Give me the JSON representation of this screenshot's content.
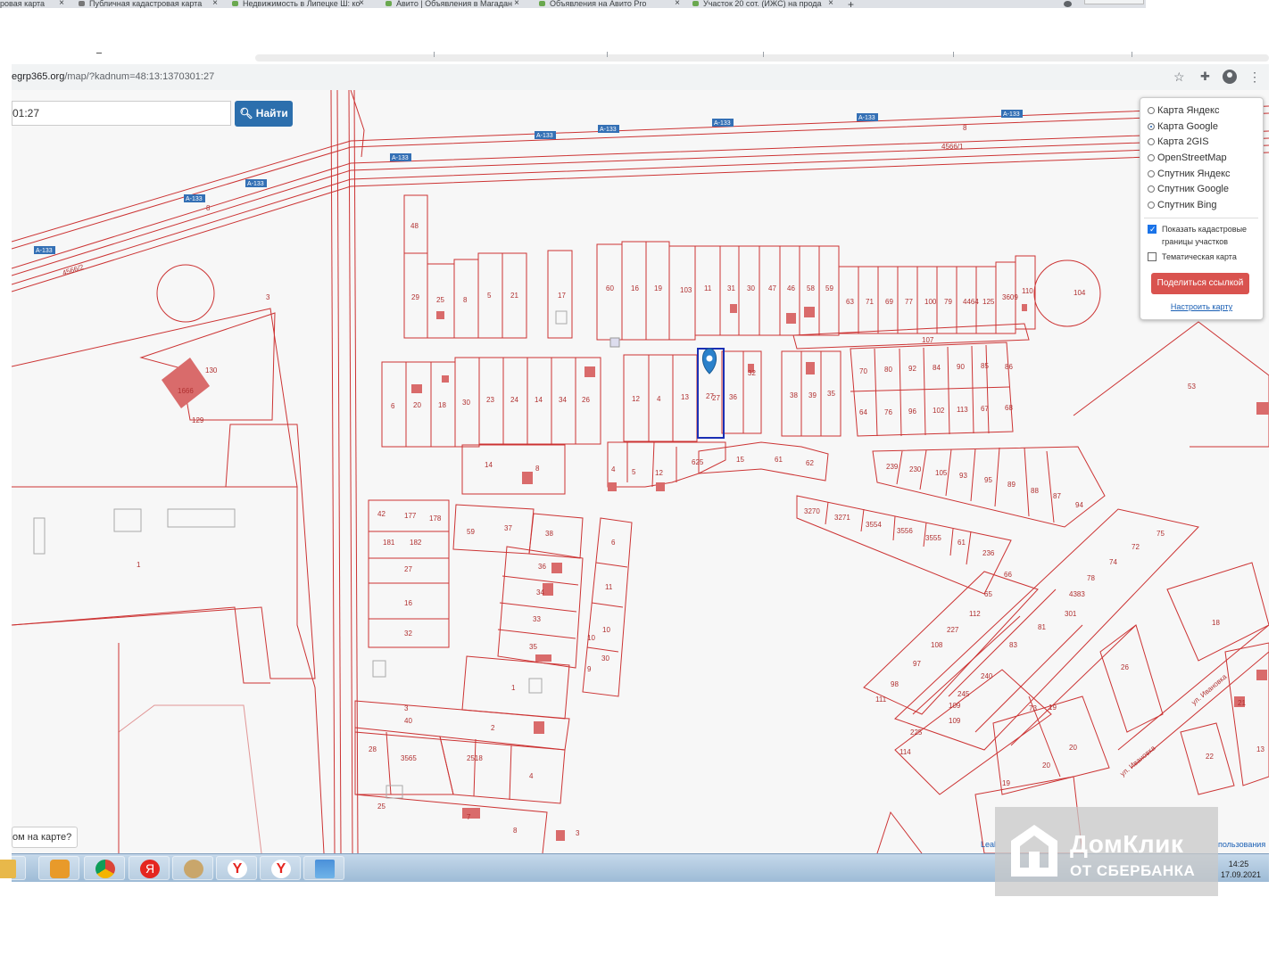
{
  "tabs": [
    {
      "label": "ровая карта"
    },
    {
      "label": "Публичная кадастровая карта"
    },
    {
      "label": "Недвижимость в Липецке Ш: ко"
    },
    {
      "label": "Авито | Объявления в Магадан"
    },
    {
      "label": "Объявления на Авито Pro"
    },
    {
      "label": "Участок 20 сот. (ИЖС) на прода"
    }
  ],
  "address_bar": {
    "domain": "egrp365.org",
    "path": "/map/?kadnum=48:13:1370301:27"
  },
  "search": {
    "value": "01:27",
    "button_label": "Найти"
  },
  "layers": {
    "options": [
      "Карта Яндекс",
      "Карта Google",
      "Карта 2GIS",
      "OpenStreetMap",
      "Спутник Яндекс",
      "Спутник Google",
      "Спутник Bing"
    ],
    "selected": "Карта Google",
    "checkbox_cadastral": "Показать кадастровые границы участков",
    "checkbox_cadastral_checked": true,
    "checkbox_thematic": "Тематическая карта",
    "checkbox_thematic_checked": false,
    "share_button": "Поделиться ссылкой",
    "configure_link": "Настроить карту"
  },
  "map": {
    "on_map_button": "ом на карте?",
    "attribution_left": "Leal",
    "attribution_right": "пользования",
    "road_labels": [
      "А-133",
      "А-133",
      "А-133",
      "А-133",
      "А-133",
      "А-133",
      "А-133",
      "А-133",
      "А-133"
    ],
    "road_numbers": [
      "4566/1",
      "4566/2",
      "8",
      "8"
    ],
    "street": "ул. Ивановка",
    "selected_parcel": "27",
    "parcel_numbers": [
      "48",
      "29",
      "25",
      "8",
      "5",
      "21",
      "17",
      "60",
      "16",
      "19",
      "103",
      "11",
      "31",
      "30",
      "47",
      "46",
      "58",
      "59",
      "63",
      "71",
      "69",
      "77",
      "100",
      "79",
      "4464",
      "125",
      "3609",
      "110",
      "104",
      "107",
      "3",
      "130",
      "1666",
      "129",
      "6",
      "20",
      "18",
      "30",
      "23",
      "24",
      "14",
      "34",
      "26",
      "12",
      "4",
      "13",
      "27",
      "36",
      "32",
      "38",
      "39",
      "35",
      "70",
      "80",
      "92",
      "84",
      "90",
      "85",
      "86",
      "64",
      "76",
      "96",
      "102",
      "113",
      "67",
      "68",
      "53",
      "1",
      "14",
      "8",
      "4",
      "5",
      "12",
      "625",
      "15",
      "61",
      "62",
      "239",
      "230",
      "105",
      "93",
      "95",
      "89",
      "88",
      "87",
      "94",
      "3270",
      "3271",
      "3554",
      "3556",
      "3555",
      "61",
      "236",
      "42",
      "177",
      "178",
      "181",
      "182",
      "27",
      "16",
      "32",
      "59",
      "37",
      "38",
      "36",
      "34",
      "33",
      "35",
      "6",
      "11",
      "10",
      "10",
      "9",
      "30",
      "1",
      "2",
      "3",
      "40",
      "28",
      "3565",
      "2518",
      "4",
      "25",
      "7",
      "8",
      "3",
      "66",
      "65",
      "112",
      "227",
      "108",
      "97",
      "98",
      "111",
      "109",
      "109",
      "225",
      "114",
      "245",
      "240",
      "83",
      "81",
      "301",
      "4383",
      "78",
      "74",
      "72",
      "75",
      "73",
      "19",
      "20",
      "20",
      "19",
      "18",
      "26",
      "22",
      "21",
      "13",
      "3",
      "19"
    ]
  },
  "taskbar": {
    "time": "14:25",
    "date": "17.09.2021"
  },
  "watermark": {
    "line1": "ДомКлик",
    "line2": "ОТ СБЕРБАНКА"
  },
  "colors": {
    "parcel": "#cc3333",
    "building": "#d96b6b",
    "selection": "#1a2fb4",
    "road_badge": "#3470b5",
    "find_button": "#2c6fad",
    "share_button": "#d9534f"
  }
}
